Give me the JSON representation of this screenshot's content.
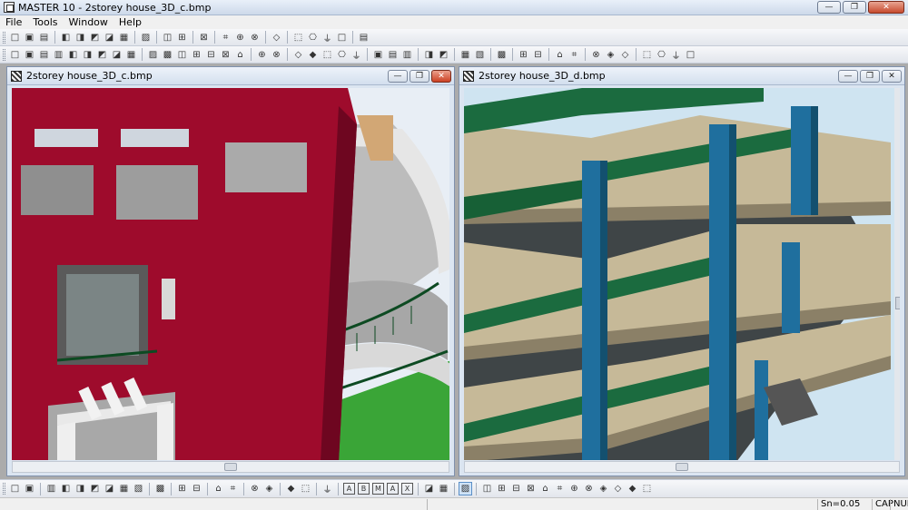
{
  "app": {
    "title": "MASTER 10 - 2storey house_3D_c.bmp",
    "controls": {
      "minimize": "—",
      "restore": "❐",
      "close": "✕"
    }
  },
  "menu": [
    "File",
    "Tools",
    "Window",
    "Help"
  ],
  "toolbar1_icons": [
    "new-icon",
    "open-icon",
    "save-icon",
    "sep",
    "print-setup-icon",
    "copy-icon",
    "print-icon",
    "print-preview-icon",
    "export-icon",
    "sep",
    "pen-icon",
    "sep",
    "grid-icon",
    "table-icon",
    "sep",
    "hatch-icon",
    "sep",
    "line-icon",
    "circle-icon",
    "undo-arc-icon",
    "sep",
    "text-icon",
    "sep",
    "dimension-icon",
    "dimension-icon-2",
    "dimension-icon-3",
    "layers-icon",
    "sep",
    "tools-icon"
  ],
  "toolbar2_icons": [
    "wall-icon",
    "slab-icon",
    "beam-icon",
    "stair-icon",
    "ramp-icon",
    "roof-icon",
    "column-icon",
    "door-icon",
    "window-icon",
    "sep",
    "opening-icon",
    "thermometer-icon",
    "footing-icon",
    "arrow-icon",
    "load-icon",
    "load-icon-2",
    "node-icon",
    "sep",
    "section-icon",
    "copy-model-icon",
    "sep",
    "zoom-model-icon",
    "move-icon",
    "zoom-icon",
    "rotate-icon",
    "mirror-icon",
    "sep",
    "list-icon",
    "rebar-icon",
    "rebar-icon-2",
    "sep",
    "anchor-icon",
    "stirrup-icon",
    "sep",
    "beam-rebar-icon",
    "slab-rebar-icon",
    "sep",
    "report-icon",
    "sep",
    "support-icon",
    "spring-icon",
    "sep",
    "bar-icon",
    "cut-icon",
    "sep",
    "frame-icon",
    "frame-icon-2",
    "frame-icon-3",
    "sep",
    "grab-icon",
    "hand-icon",
    "close-model-icon",
    "print-model-icon"
  ],
  "windows": [
    {
      "title": "2storey house_3D_c.bmp",
      "scroll": 0.5
    },
    {
      "title": "2storey house_3D_d.bmp",
      "scroll": 0.5
    }
  ],
  "toolbar3_icons": [
    "undo-icon",
    "redo-icon",
    "sep",
    "pin-icon",
    "zoom-in-icon",
    "zoom-out-icon",
    "zoom-window-icon",
    "zoom-extents-icon",
    "zoom-previous-icon",
    "zoom-all-icon",
    "sep",
    "grid-toggle-icon",
    "sep",
    "snap-icon",
    "angle-icon",
    "sep",
    "measure-icon",
    "measure-2-icon",
    "sep",
    "polyline-icon",
    "arc-icon",
    "sep",
    "hatch-fill-icon",
    "block-icon",
    "sep",
    "layer-icon",
    "sep",
    "A",
    "B",
    "M",
    "A",
    "X",
    "sep",
    "plus-icon",
    "minus-icon",
    "sep",
    "cursor-icon",
    "sep",
    "crosshair-icon",
    "window-select-icon",
    "beam-draw-icon",
    "line-draw-icon",
    "rect-icon",
    "parallelogram-icon",
    "ab-icon",
    "arrows-icon",
    "grid-draw-icon",
    "arrow-right-icon",
    "stretch-icon",
    "frame-select-icon"
  ],
  "status": {
    "snap": "Sn=0.05",
    "caps": "CAP",
    "num": "NUM"
  },
  "colors": {
    "accent_red": "#9e0b2c",
    "column_blue": "#1f6f9e",
    "beam_green": "#1b6b3f",
    "slab": "#c6b998",
    "sky": "#cfe4f1"
  }
}
